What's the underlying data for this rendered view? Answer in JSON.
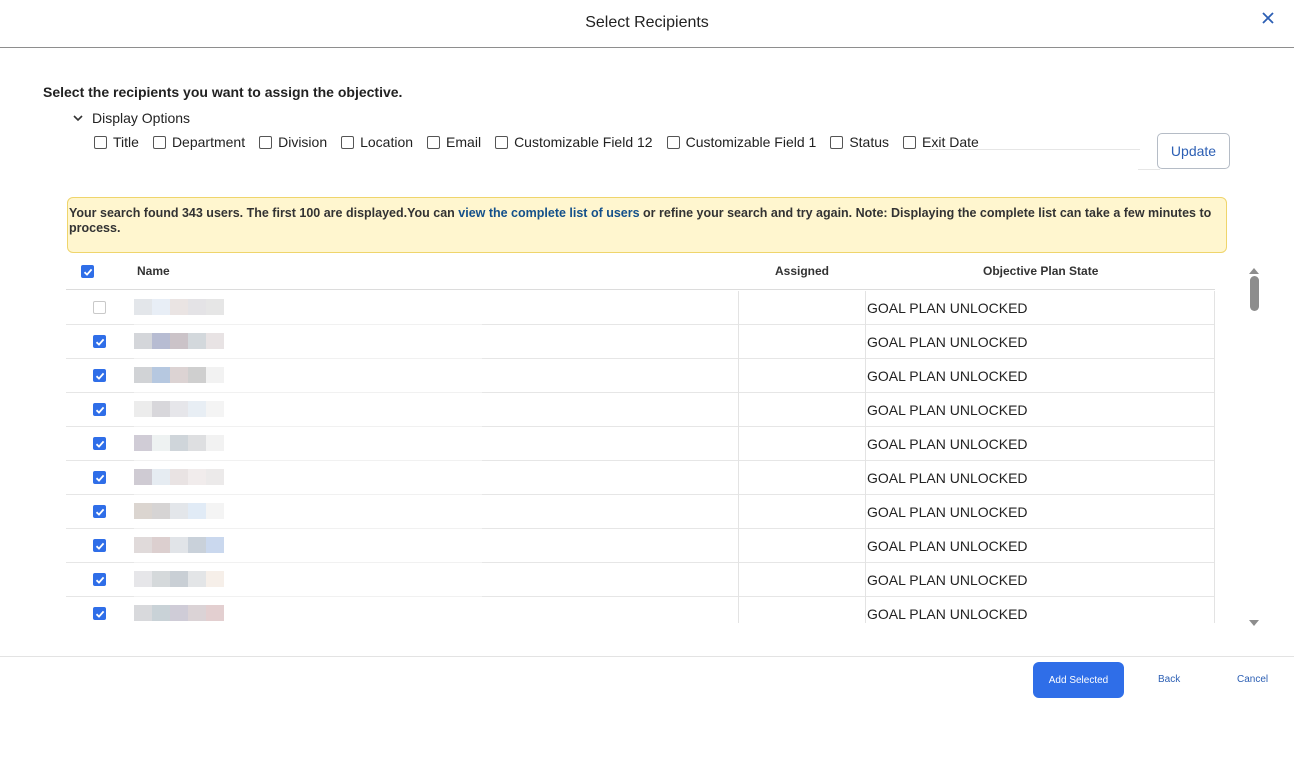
{
  "dialog": {
    "title": "Select Recipients",
    "close_icon": "close-icon"
  },
  "instructions": "Select the recipients you want to assign the objective.",
  "display_options": {
    "label": "Display Options",
    "toggle_icon": "chevron-down-icon",
    "options": [
      "Title",
      "Department",
      "Division",
      "Location",
      "Email",
      "Customizable Field 12",
      "Customizable Field 1",
      "Status",
      "Exit Date"
    ],
    "update_label": "Update"
  },
  "notice": {
    "before": "Your search found 343 users. The first 100 are displayed.You can ",
    "link": "view the complete list of users",
    "after": " or refine your search and try again. Note: Displaying the complete list can take a few minutes to process."
  },
  "table": {
    "headers": {
      "name": "Name",
      "assigned": "Assigned",
      "state": "Objective Plan State"
    },
    "header_checked": true,
    "rows": [
      {
        "checked": false,
        "state": "GOAL PLAN UNLOCKED"
      },
      {
        "checked": true,
        "state": "GOAL PLAN UNLOCKED"
      },
      {
        "checked": true,
        "state": "GOAL PLAN UNLOCKED"
      },
      {
        "checked": true,
        "state": "GOAL PLAN UNLOCKED"
      },
      {
        "checked": true,
        "state": "GOAL PLAN UNLOCKED"
      },
      {
        "checked": true,
        "state": "GOAL PLAN UNLOCKED"
      },
      {
        "checked": true,
        "state": "GOAL PLAN UNLOCKED"
      },
      {
        "checked": true,
        "state": "GOAL PLAN UNLOCKED"
      },
      {
        "checked": true,
        "state": "GOAL PLAN UNLOCKED"
      },
      {
        "checked": true,
        "state": "GOAL PLAN UNLOCKED"
      }
    ]
  },
  "footer": {
    "add_label": "Add Selected",
    "back_label": "Back",
    "cancel_label": "Cancel"
  },
  "colors": {
    "primary": "#2f6ee8",
    "link": "#2c5fb4",
    "notice_bg": "#fff6cf",
    "notice_border": "#efd56c"
  }
}
